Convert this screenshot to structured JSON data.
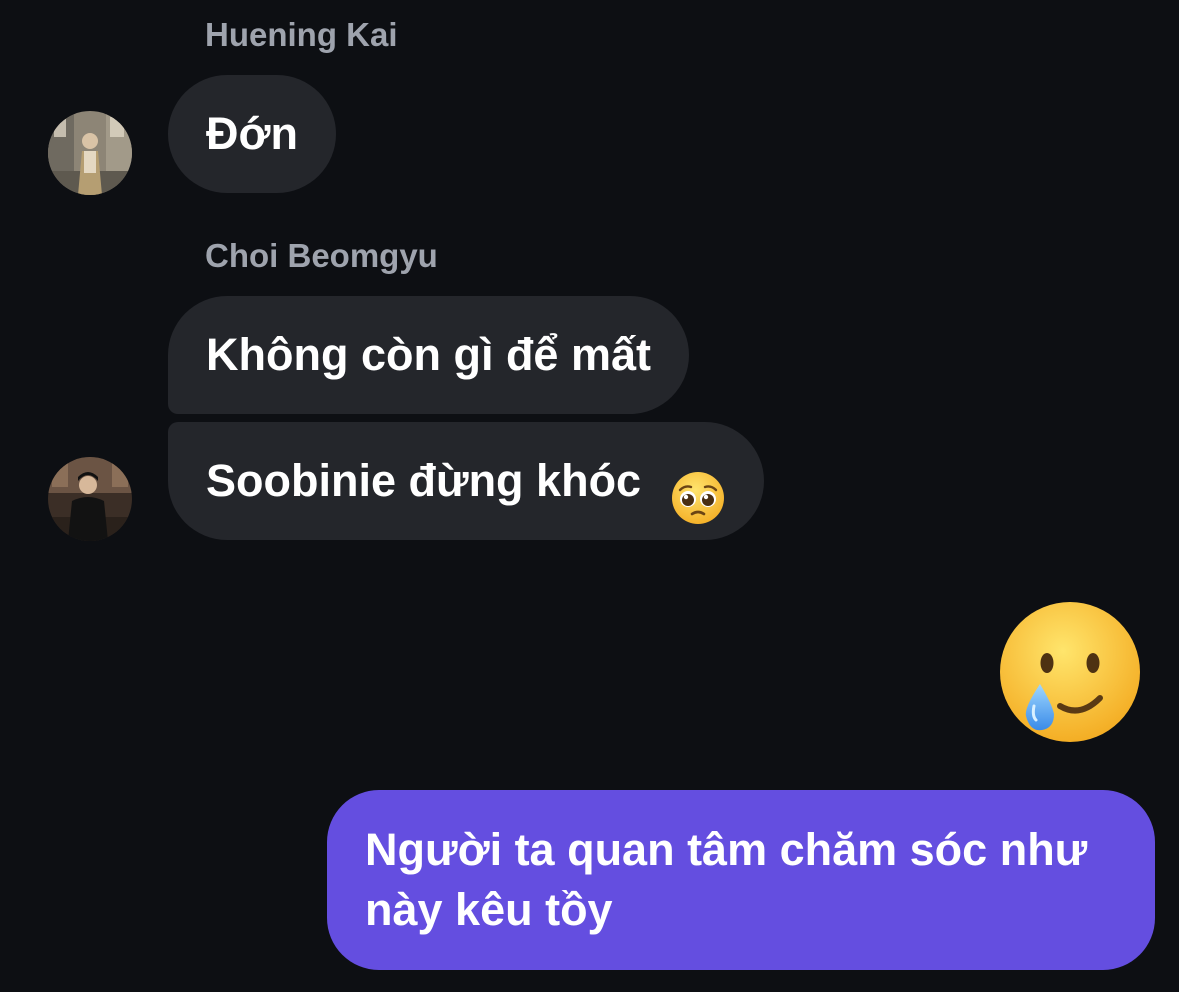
{
  "messages": {
    "group1": {
      "sender": "Huening Kai",
      "text": "Đớn"
    },
    "group2": {
      "sender": "Choi Beomgyu",
      "text1": "Không còn gì để mất",
      "text2": "Soobinie đừng khóc",
      "emoji": "pleading-face-emoji"
    },
    "sent": {
      "emoji": "smiling-face-with-tear-emoji",
      "line1": "Người ta quan tâm chăm sóc như",
      "line2": "này kêu tồy"
    }
  },
  "colors": {
    "background": "#0d0f13",
    "incoming_bubble": "#24262b",
    "outgoing_bubble": "#644ee0",
    "sender_name": "#9ea3ad",
    "text": "#ffffff"
  }
}
